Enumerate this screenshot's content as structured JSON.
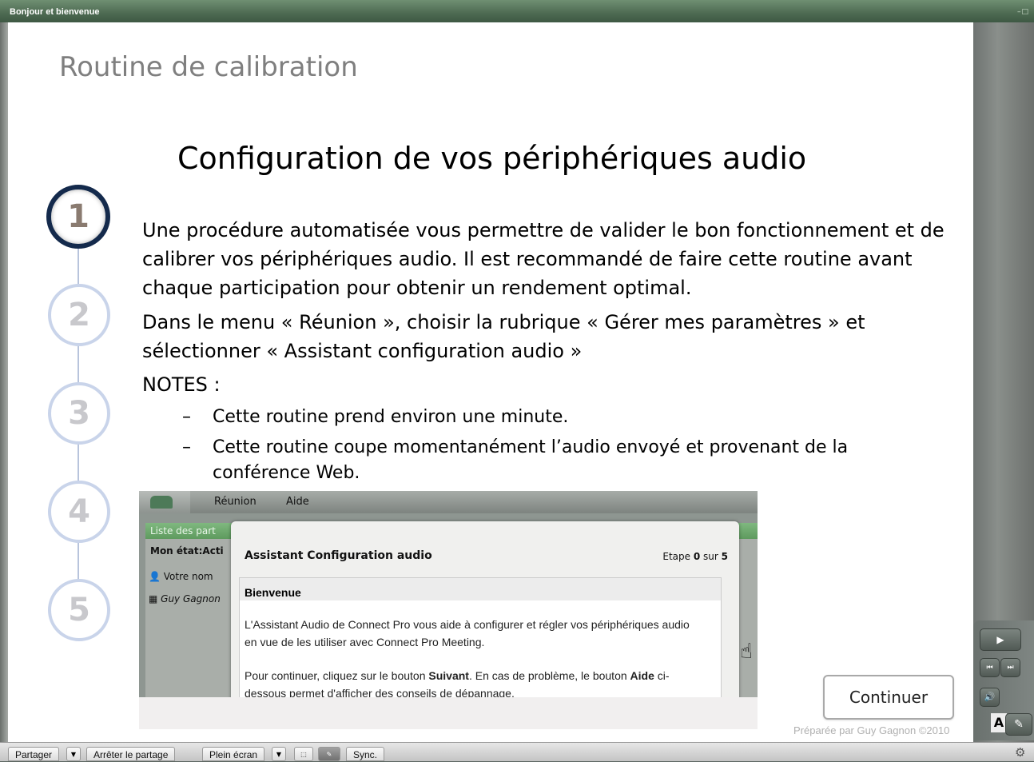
{
  "window": {
    "title": "Bonjour et bienvenue",
    "controls": "–□"
  },
  "slide": {
    "heading": "Routine de calibration",
    "title": "Configuration de vos périphériques audio",
    "paragraph1": "Une procédure automatisée vous permettre de valider le bon fonctionnement et de calibrer vos périphériques audio.  Il est recommandé de faire cette routine avant chaque participation pour obtenir un rendement optimal.",
    "paragraph2": "Dans le menu « Réunion », choisir la rubrique « Gérer mes paramètres » et sélectionner « Assistant configuration audio »",
    "notes_label": "NOTES :",
    "bullet_dash": "–",
    "bullets": [
      "Cette routine prend environ une minute.",
      "Cette routine coupe momentanément l’audio envoyé et provenant de la conférence Web."
    ],
    "steps": [
      "1",
      "2",
      "3",
      "4",
      "5"
    ],
    "active_step": 1,
    "continue_label": "Continuer",
    "credit": "Préparée par Guy Gagnon ©2010"
  },
  "screenshot": {
    "menu": [
      "Réunion",
      "Aide"
    ],
    "panel_title": "Liste des part",
    "status": "Mon état:Acti",
    "participants": [
      "Votre nom",
      "Guy Gagnon"
    ],
    "dialog": {
      "title": "Assistant Configuration audio",
      "step_prefix": "Etape ",
      "step_current": "0",
      "step_mid": " sur ",
      "step_total": "5",
      "section": "Bienvenue",
      "text1": "L'Assistant Audio de Connect Pro vous aide à configurer et régler vos périphériques audio en vue de les utiliser avec Connect Pro Meeting.",
      "text2_a": "Pour continuer, cliquez sur le bouton ",
      "text2_b": "Suivant",
      "text2_c": ". En cas de problème, le bouton ",
      "text2_d": "Aide",
      "text2_e": " ci-dessous permet d'afficher des conseils de dépannage."
    }
  },
  "player": {
    "play_icon": "▶",
    "prev_icon": "⏮",
    "next_icon": "⏭",
    "volume_icon": "🔊",
    "edit_icon": "✎"
  },
  "bottombar": {
    "share": "Partager",
    "stop_share": "Arrêter le partage",
    "fullscreen": "Plein écran",
    "sync": "Sync.",
    "dropdown_icon": "▼",
    "pointer_icon": "⬚",
    "annotate_icon": "✎",
    "gear_icon": "⚙"
  }
}
